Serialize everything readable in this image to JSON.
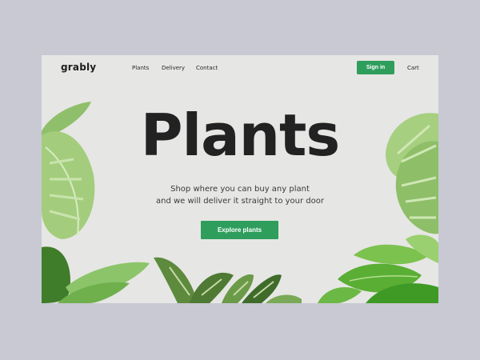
{
  "brand": {
    "name": "grably"
  },
  "nav": {
    "links": [
      "Plants",
      "Delivery",
      "Contact"
    ],
    "signin_label": "Sign in",
    "cart_label": "Cart"
  },
  "hero": {
    "title": "Plants",
    "subtitle_line1": "Shop where you can buy any plant",
    "subtitle_line2": "and we will deliver it straight to your door",
    "cta_label": "Explore plants"
  },
  "colors": {
    "accent": "#2f9e5d",
    "page_bg": "#c8c9d3",
    "frame_bg": "#e6e6e4",
    "text": "#222222"
  }
}
